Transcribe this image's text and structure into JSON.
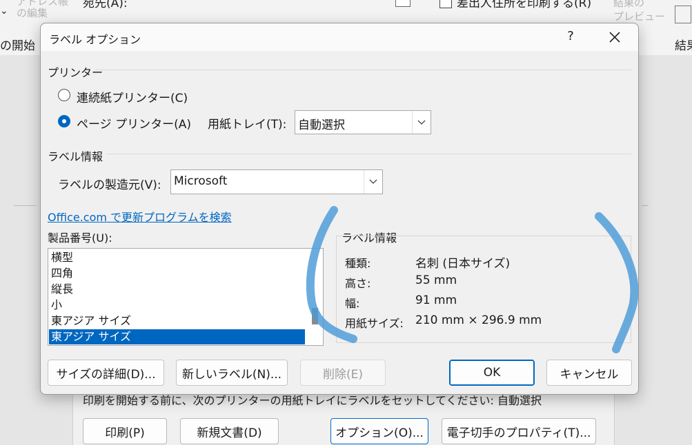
{
  "background": {
    "ribbon": {
      "address_book_edit": "アドレス帳\nの編集",
      "address_label": "宛先(A):",
      "print_return_address": "差出人住所を印刷する(R)",
      "preview_label": "結果の\nプレビュー",
      "start_label": "の開始",
      "result_label": "結果"
    },
    "footer_instruction": "印刷を開始する前に、次のプリンターの用紙トレイにラベルをセットしてください: 自動選択",
    "buttons": {
      "print": "印刷(P)",
      "new_document": "新規文書(D)",
      "options": "オプション(O)...",
      "stamp_properties": "電子切手のプロパティ(T)..."
    }
  },
  "dialog": {
    "title": "ラベル オプション",
    "help": "?",
    "printer_section": "プリンター",
    "continuous_printer": "連続紙プリンター(C)",
    "page_printer": "ページ プリンター(A)",
    "tray_label": "用紙トレイ(T):",
    "tray_value": "自動選択",
    "label_section": "ラベル情報",
    "vendor_label": "ラベルの製造元(V):",
    "vendor_value": "Microsoft",
    "update_link": "Office.com で更新プログラムを検索",
    "product_label": "製品番号(U):",
    "products": [
      "横型",
      "四角",
      "縦長",
      "小",
      "東アジア サイズ",
      "東アジア サイズ"
    ],
    "selected_index": 5,
    "info": {
      "title": "ラベル情報",
      "type_key": "種類:",
      "type_value": "名刺 (日本サイズ)",
      "height_key": "高さ:",
      "height_value": "55 mm",
      "width_key": "幅:",
      "width_value": "91 mm",
      "paper_key": "用紙サイズ:",
      "paper_value": "210 mm × 296.9 mm"
    },
    "buttons": {
      "details": "サイズの詳細(D)...",
      "new_label": "新しいラベル(N)...",
      "delete": "削除(E)",
      "ok": "OK",
      "cancel": "キャンセル"
    }
  },
  "colors": {
    "accent": "#0067c0",
    "annotation": "#4a9ad8"
  }
}
